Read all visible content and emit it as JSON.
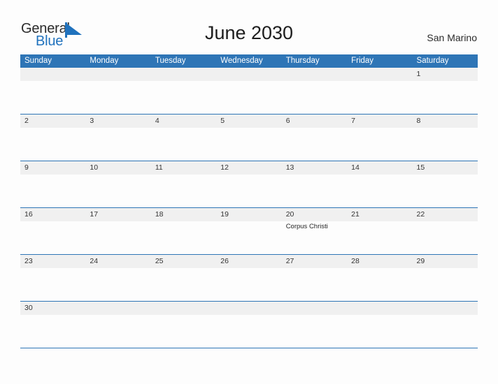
{
  "brand": {
    "name_part1": "General",
    "name_part2": "Blue",
    "flag_icon": "blue-triangle-flag-icon",
    "color_dark": "#2b2b2b",
    "color_blue": "#2072bd"
  },
  "header": {
    "title": "June 2030",
    "region": "San Marino"
  },
  "theme": {
    "header_blue": "#2e75b6",
    "row_divider_blue": "#2e75b6",
    "day_band_gray": "#f0f0f0",
    "page_background": "#fdfdfd",
    "text_dark": "#262626"
  },
  "calendar": {
    "month": "June",
    "year": "2030",
    "weekdays": [
      "Sunday",
      "Monday",
      "Tuesday",
      "Wednesday",
      "Thursday",
      "Friday",
      "Saturday"
    ],
    "weeks": [
      [
        {
          "day": "",
          "events": []
        },
        {
          "day": "",
          "events": []
        },
        {
          "day": "",
          "events": []
        },
        {
          "day": "",
          "events": []
        },
        {
          "day": "",
          "events": []
        },
        {
          "day": "",
          "events": []
        },
        {
          "day": "1",
          "events": []
        }
      ],
      [
        {
          "day": "2",
          "events": []
        },
        {
          "day": "3",
          "events": []
        },
        {
          "day": "4",
          "events": []
        },
        {
          "day": "5",
          "events": []
        },
        {
          "day": "6",
          "events": []
        },
        {
          "day": "7",
          "events": []
        },
        {
          "day": "8",
          "events": []
        }
      ],
      [
        {
          "day": "9",
          "events": []
        },
        {
          "day": "10",
          "events": []
        },
        {
          "day": "11",
          "events": []
        },
        {
          "day": "12",
          "events": []
        },
        {
          "day": "13",
          "events": []
        },
        {
          "day": "14",
          "events": []
        },
        {
          "day": "15",
          "events": []
        }
      ],
      [
        {
          "day": "16",
          "events": []
        },
        {
          "day": "17",
          "events": []
        },
        {
          "day": "18",
          "events": []
        },
        {
          "day": "19",
          "events": []
        },
        {
          "day": "20",
          "events": [
            "Corpus Christi"
          ]
        },
        {
          "day": "21",
          "events": []
        },
        {
          "day": "22",
          "events": []
        }
      ],
      [
        {
          "day": "23",
          "events": []
        },
        {
          "day": "24",
          "events": []
        },
        {
          "day": "25",
          "events": []
        },
        {
          "day": "26",
          "events": []
        },
        {
          "day": "27",
          "events": []
        },
        {
          "day": "28",
          "events": []
        },
        {
          "day": "29",
          "events": []
        }
      ],
      [
        {
          "day": "30",
          "events": []
        },
        {
          "day": "",
          "events": []
        },
        {
          "day": "",
          "events": []
        },
        {
          "day": "",
          "events": []
        },
        {
          "day": "",
          "events": []
        },
        {
          "day": "",
          "events": []
        },
        {
          "day": "",
          "events": []
        }
      ]
    ]
  }
}
